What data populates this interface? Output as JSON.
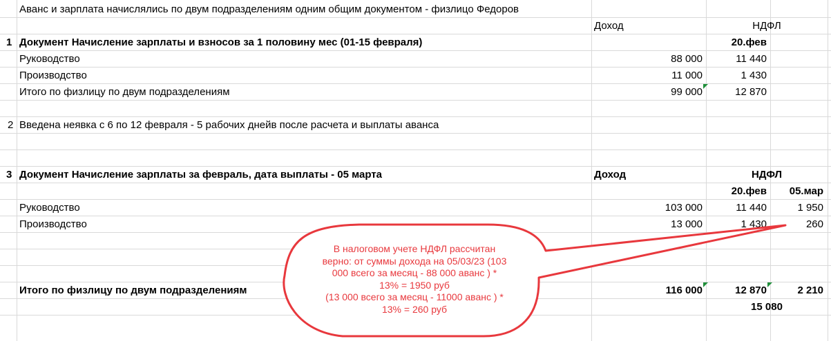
{
  "sheet": {
    "title": "Аванс и зарплата начислялись по двум подразделениям одним общим документом - физлицо Федоров",
    "header1": {
      "income": "Доход",
      "ndfl": "НДФЛ"
    },
    "section1": {
      "num": "1",
      "title": "Документ Начисление зарплаты и взносов за 1 половину мес (01-15 февраля)",
      "date": "20.фев",
      "rows": [
        {
          "label": "Руководство",
          "income": "88 000",
          "ndfl": "11 440"
        },
        {
          "label": "Производство",
          "income": "11 000",
          "ndfl": "1 430"
        },
        {
          "label": "Итого по физлицу по двум подразделениям",
          "income": "99 000",
          "ndfl": "12 870"
        }
      ]
    },
    "section2": {
      "num": "2",
      "text": " Введена неявка  с 6 по 12 февраля - 5 рабочих днейв после расчета  и  выплаты аванса"
    },
    "section3": {
      "num": "3",
      "title": "Документ  Начисление зарплаты за февраль, дата выплаты - 05 марта",
      "income_header": "Доход",
      "ndfl_header": "НДФЛ",
      "date1": "20.фев",
      "date2": "05.мар",
      "rows": [
        {
          "label": "Руководство",
          "income": "103 000",
          "ndfl1": "11 440",
          "ndfl2": "1 950"
        },
        {
          "label": "Производство",
          "income": "13 000",
          "ndfl1": "1 430",
          "ndfl2": "260"
        }
      ],
      "total": {
        "label": "Итого по физлицу по двум подразделениям",
        "income": "116 000",
        "ndfl1": "12 870",
        "ndfl2": "2 210"
      },
      "grand_total": "15 080"
    }
  },
  "callout": {
    "lines": [
      "В налоговом учете НДФЛ рассчитан",
      "верно: от суммы дохода на 05/03/23 (103",
      "000 всего за месяц  - 88 000 аванс ) *",
      "13% = 1950 руб",
      "(13 000 всего за месяц  - 11000 аванс ) *",
      "13% = 260 руб"
    ],
    "color": "#e8383d"
  },
  "colors": {
    "grid": "#d9d9d9",
    "comment_marker": "#1f8f3a"
  }
}
